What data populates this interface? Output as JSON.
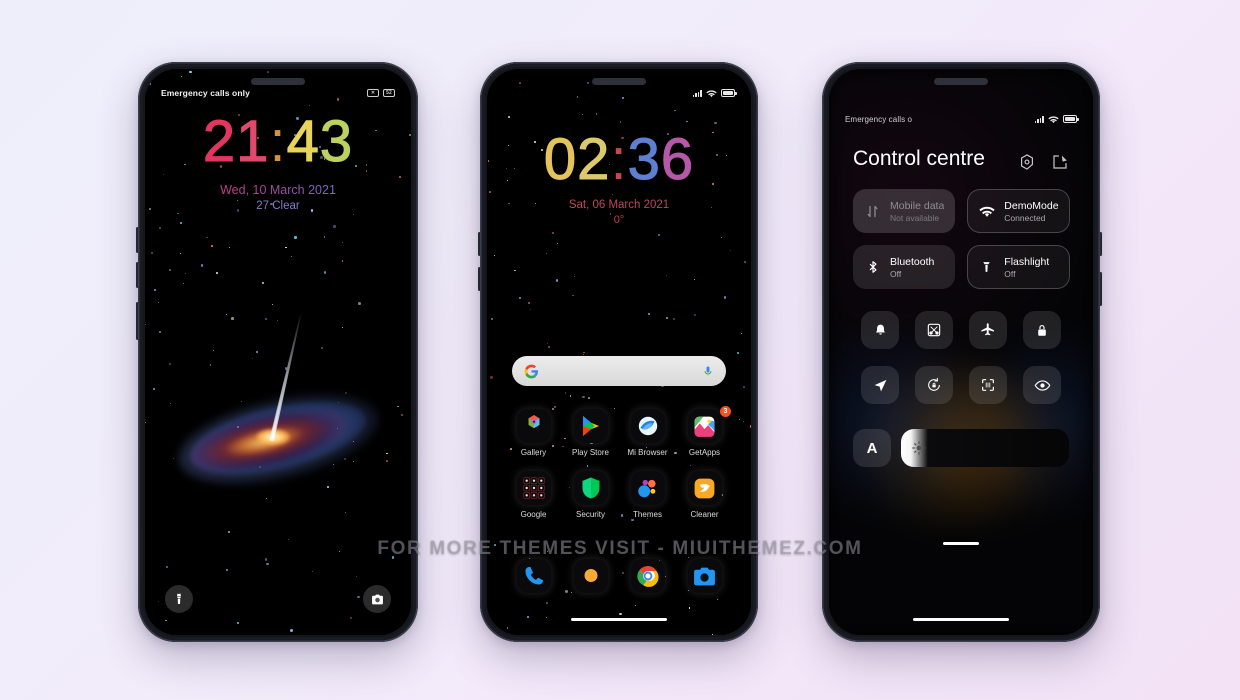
{
  "watermark": "FOR MORE THEMES VISIT - MIUITHEMEZ.COM",
  "background": {
    "from": "#eeeefb",
    "to": "#f3e2f6"
  },
  "phone1": {
    "name": "lock-screen",
    "statusbar": {
      "carrier": "Emergency calls only",
      "icons": [
        "mute-icon",
        "battery-icon"
      ]
    },
    "clock": {
      "d1": "2",
      "d2": "1",
      "sep": ":",
      "d3": "4",
      "d4": "3",
      "colors": [
        "#e0365f",
        "#e04a6a",
        "#e7d45a",
        "#bcd160"
      ],
      "sep_color": "#d8913c"
    },
    "date": "Wed, 10 March 2021",
    "weather": "27 Clear",
    "shortcuts": [
      {
        "name": "flashlight-shortcut",
        "icon": "flashlight-icon"
      },
      {
        "name": "camera-shortcut",
        "icon": "camera-icon"
      }
    ],
    "wallpaper": "galaxy-with-jet"
  },
  "phone2": {
    "name": "home-screen",
    "statusbar": {
      "icons": [
        "signal-icon",
        "wifi-icon",
        "battery-icon"
      ]
    },
    "clock": {
      "d1": "0",
      "d2": "2",
      "sep": ":",
      "d3": "3",
      "d4": "6",
      "colors": [
        "#e4c35a",
        "#dcc96b",
        "#5f7fd0",
        "#b558a8"
      ],
      "sep_color": "#c8474e"
    },
    "date": "Sat, 06 March 2021",
    "weather": "0°",
    "search": {
      "placeholder": "",
      "left_icon": "google-g-icon",
      "right_icon": "microphone-icon"
    },
    "apps": [
      {
        "label": "Gallery",
        "icon": "gallery-icon",
        "badge": ""
      },
      {
        "label": "Play Store",
        "icon": "play-store-icon",
        "badge": ""
      },
      {
        "label": "Mi Browser",
        "icon": "mi-browser-icon",
        "badge": ""
      },
      {
        "label": "GetApps",
        "icon": "getapps-icon",
        "badge": "3"
      },
      {
        "label": "Google",
        "icon": "google-folder-icon",
        "badge": ""
      },
      {
        "label": "Security",
        "icon": "security-icon",
        "badge": ""
      },
      {
        "label": "Themes",
        "icon": "themes-icon",
        "badge": ""
      },
      {
        "label": "Cleaner",
        "icon": "cleaner-icon",
        "badge": ""
      }
    ],
    "dock": [
      {
        "label": "Phone",
        "icon": "phone-icon"
      },
      {
        "label": "Messages",
        "icon": "messages-icon"
      },
      {
        "label": "Chrome",
        "icon": "chrome-icon"
      },
      {
        "label": "Camera",
        "icon": "camera-icon"
      }
    ]
  },
  "phone3": {
    "name": "control-centre",
    "statusbar": {
      "carrier": "Emergency calls o",
      "icons": [
        "signal-icon",
        "wifi-icon",
        "battery-icon"
      ]
    },
    "title": "Control centre",
    "actions": [
      {
        "name": "settings-icon",
        "label": "Settings"
      },
      {
        "name": "edit-icon",
        "label": "Edit"
      }
    ],
    "big_tiles": [
      {
        "name": "Mobile data",
        "state": "Not available",
        "icon": "mobile-data-icon",
        "status": "disabled"
      },
      {
        "name": "DemoMode",
        "state": "Connected",
        "icon": "wifi-icon",
        "status": "on"
      },
      {
        "name": "Bluetooth",
        "state": "Off",
        "icon": "bluetooth-icon",
        "status": "off"
      },
      {
        "name": "Flashlight",
        "state": "Off",
        "icon": "flashlight-icon",
        "status": "highlighted"
      }
    ],
    "small_tiles": [
      {
        "icon": "bell-icon",
        "label": "Silent"
      },
      {
        "icon": "screenshot-icon",
        "label": "Screenshot"
      },
      {
        "icon": "airplane-icon",
        "label": "Airplane mode"
      },
      {
        "icon": "lock-icon",
        "label": "Lock"
      },
      {
        "icon": "location-icon",
        "label": "Location"
      },
      {
        "icon": "rotation-lock-icon",
        "label": "Auto rotate"
      },
      {
        "icon": "scanner-icon",
        "label": "Scanner"
      },
      {
        "icon": "reading-mode-icon",
        "label": "Reading mode"
      }
    ],
    "brightness": {
      "auto_label": "A",
      "icon": "sun-icon",
      "value": 12
    }
  }
}
